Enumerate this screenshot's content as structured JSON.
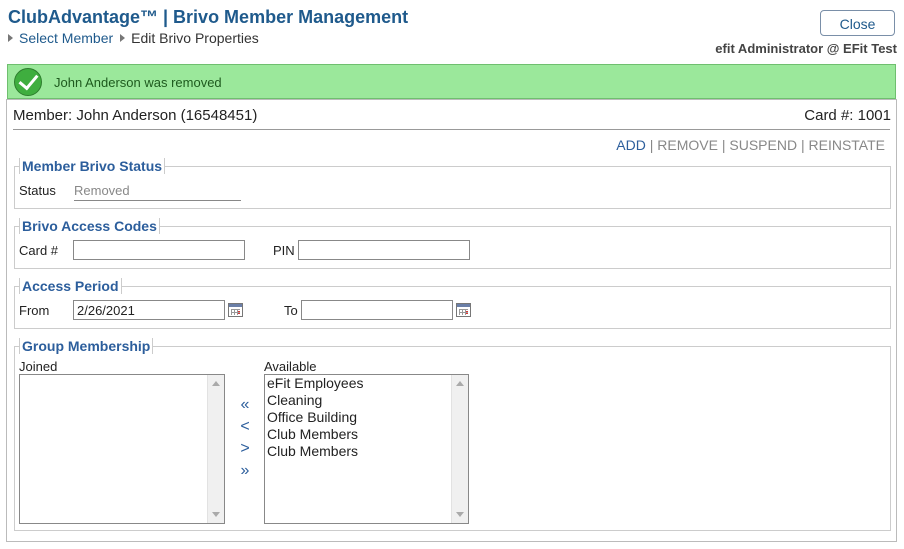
{
  "header": {
    "title": "ClubAdvantage™ | Brivo Member Management",
    "breadcrumb": [
      "Select Member",
      "Edit Brivo Properties"
    ],
    "close_label": "Close",
    "admin": "efit Administrator @ EFit Test"
  },
  "banner": {
    "message": "John Anderson was removed",
    "color": "#9be89b"
  },
  "member": {
    "label": "Member: John Anderson (16548451)",
    "card": "Card #: 1001"
  },
  "actions": [
    "ADD",
    "REMOVE",
    "SUSPEND",
    "REINSTATE"
  ],
  "status_section": {
    "legend": "Member Brivo Status",
    "status_label": "Status",
    "status_value": "Removed"
  },
  "codes_section": {
    "legend": "Brivo Access Codes",
    "card_label": "Card #",
    "card_value": "",
    "pin_label": "PIN",
    "pin_value": ""
  },
  "period_section": {
    "legend": "Access Period",
    "from_label": "From",
    "from_value": "2/26/2021",
    "to_label": "To",
    "to_value": ""
  },
  "group_section": {
    "legend": "Group Membership",
    "joined_label": "Joined",
    "available_label": "Available",
    "joined": [],
    "available": [
      "eFit Employees",
      "Cleaning",
      "Office Building",
      "Club Members",
      "Club Members"
    ],
    "move_buttons": [
      "«",
      "<",
      ">",
      "»"
    ]
  }
}
